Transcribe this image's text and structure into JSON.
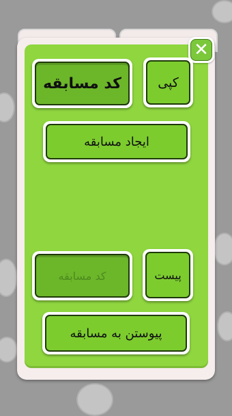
{
  "dialog": {
    "close_symbol": "✕",
    "copy_button_label": "کپی",
    "race_code_label": "کد مسابقه",
    "create_race_button_label": "ایجاد مسابقه",
    "paste_button_label": "پیست",
    "race_code_input_placeholder": "کد مسابقه",
    "join_race_button_label": "پیوستن به مسابقه"
  },
  "colors": {
    "background": "#9a9a9a",
    "panel": "#f6eded",
    "accent_green": "#8fd63f",
    "button_green": "#7ccc2e",
    "field_green": "#6cb62a"
  }
}
